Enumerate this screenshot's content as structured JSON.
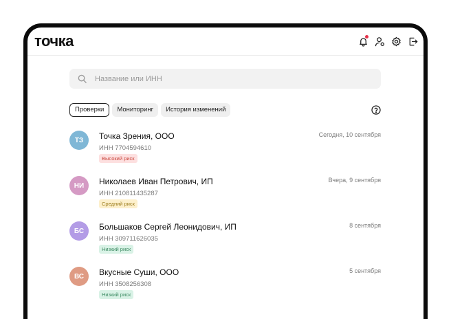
{
  "header": {
    "logo": "точка",
    "icons": [
      "bell-icon",
      "user-icon",
      "gear-icon",
      "logout-icon"
    ],
    "notification_color": "#e5334b"
  },
  "search": {
    "placeholder": "Название или ИНН",
    "value": ""
  },
  "tabs": [
    {
      "label": "Проверки",
      "active": true
    },
    {
      "label": "Мониторинг",
      "active": false
    },
    {
      "label": "История изменений",
      "active": false
    }
  ],
  "help_icon": "question-circle-icon",
  "companies": [
    {
      "initials": "ТЗ",
      "name": "Точка Зрения, ООО",
      "inn": "ИНН 7704594610",
      "risk": "Высокий риск",
      "risk_level": "high",
      "date": "Сегодня, 10 сентября",
      "avatar_color": "#7fb7d6"
    },
    {
      "initials": "НИ",
      "name": "Николаев Иван Петрович, ИП",
      "inn": "ИНН 210811435287",
      "risk": "Средний риск",
      "risk_level": "medium",
      "date": "Вчера, 9 сентября",
      "avatar_color": "#d59ac4"
    },
    {
      "initials": "БС",
      "name": "Большаков Сергей Леонидович, ИП",
      "inn": "ИНН 309711626035",
      "risk": "Низкий риск",
      "risk_level": "low",
      "date": "8 сентября",
      "avatar_color": "#b39ce6"
    },
    {
      "initials": "ВС",
      "name": "Вкусные Суши, ООО",
      "inn": "ИНН 3508256308",
      "risk": "Низкий риск",
      "risk_level": "low",
      "date": "5 сентября",
      "avatar_color": "#df9b83"
    }
  ],
  "risk_colors": {
    "high": {
      "bg": "#fde0e0",
      "fg": "#c9463d"
    },
    "medium": {
      "bg": "#fdf0cc",
      "fg": "#9a7a1a"
    },
    "low": {
      "bg": "#d9f2e6",
      "fg": "#3c8a62"
    }
  }
}
